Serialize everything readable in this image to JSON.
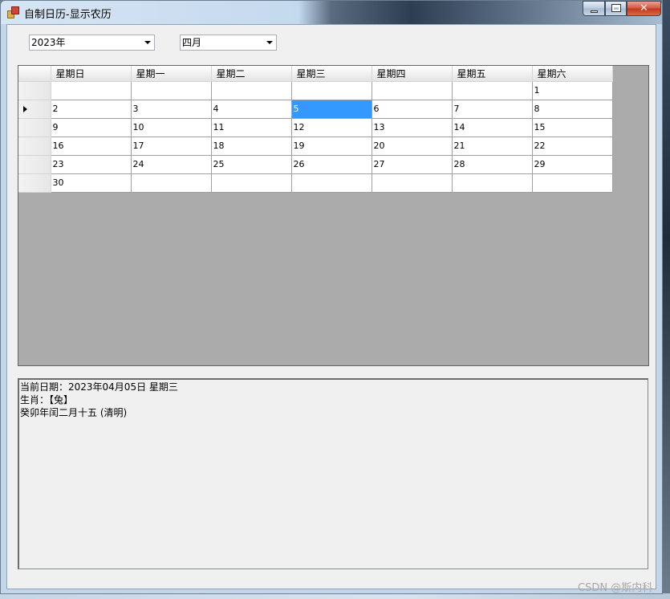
{
  "window": {
    "title": "自制日历-显示农历",
    "controls": {
      "minimize": "minimize-icon",
      "maximize": "maximize-icon",
      "close": "✕"
    }
  },
  "selectors": {
    "year": "2023年",
    "month": "四月"
  },
  "calendar": {
    "headers": [
      "星期日",
      "星期一",
      "星期二",
      "星期三",
      "星期四",
      "星期五",
      "星期六"
    ],
    "rows": [
      [
        "",
        "",
        "",
        "",
        "",
        "",
        "1"
      ],
      [
        "2",
        "3",
        "4",
        "5",
        "6",
        "7",
        "8"
      ],
      [
        "9",
        "10",
        "11",
        "12",
        "13",
        "14",
        "15"
      ],
      [
        "16",
        "17",
        "18",
        "19",
        "20",
        "21",
        "22"
      ],
      [
        "23",
        "24",
        "25",
        "26",
        "27",
        "28",
        "29"
      ],
      [
        "30",
        "",
        "",
        "",
        "",
        "",
        ""
      ]
    ],
    "selected": "5"
  },
  "info": {
    "line1": "当前日期：2023年04月05日 星期三",
    "line2": "生肖：【兔】",
    "line3": "癸卯年闰二月十五 (清明)"
  },
  "colors": {
    "selection": "#3399ff",
    "grid_background": "#ababab"
  },
  "watermark": "CSDN @斯内科"
}
